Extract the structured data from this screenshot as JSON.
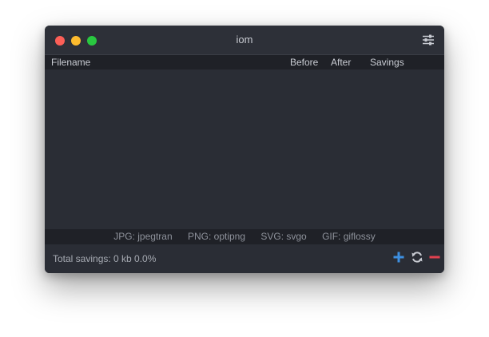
{
  "window": {
    "title": "iom"
  },
  "table": {
    "columns": {
      "filename": "Filename",
      "before": "Before",
      "after": "After",
      "savings": "Savings"
    },
    "rows": []
  },
  "tools": {
    "jpg": "JPG: jpegtran",
    "png": "PNG: optipng",
    "svg": "SVG: svgo",
    "gif": "GIF: giflossy"
  },
  "footer": {
    "total_savings": "Total savings: 0 kb 0.0%"
  },
  "icons": {
    "settings": "sliders-icon",
    "add": "plus-icon",
    "refresh": "refresh-icon",
    "remove": "minus-icon"
  },
  "colors": {
    "close": "#fc5f57",
    "minimize": "#fdbb2e",
    "zoom": "#29c840",
    "add": "#3d8fe0",
    "remove": "#e0414f",
    "refresh": "#c9ccd3"
  }
}
